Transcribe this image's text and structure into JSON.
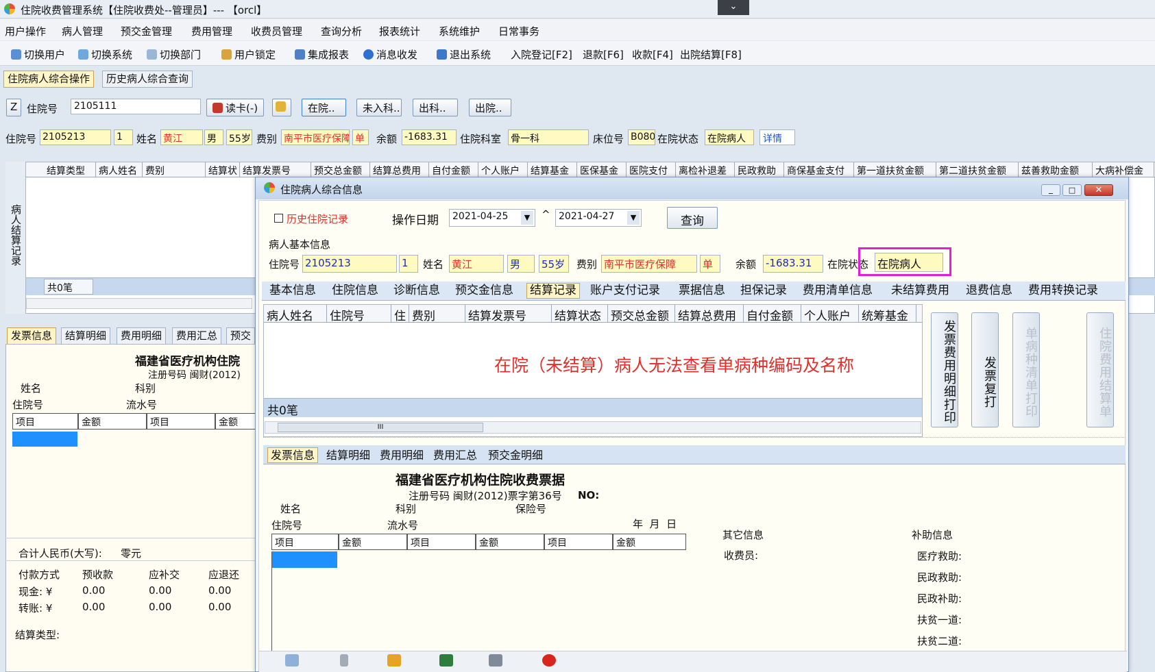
{
  "window": {
    "title": "住院收费管理系统【住院收费处--管理员】--- 【orcl】"
  },
  "menu": [
    "用户操作",
    "病人管理",
    "预交金管理",
    "费用管理",
    "收费员管理",
    "查询分析",
    "报表统计",
    "系统维护",
    "日常事务"
  ],
  "toolbar": [
    "切换用户",
    "切换系统",
    "切换部门",
    "用户锁定",
    "集成报表",
    "消息收发",
    "退出系统",
    "入院登记[F2]",
    "退款[F6]",
    "收款[F4]",
    "出院结算[F8]"
  ],
  "main_tabs": [
    "住院病人综合操作",
    "历史病人综合查询"
  ],
  "search": {
    "z": "Z",
    "label": "住院号",
    "value": "2105111",
    "read_card": "读卡(-)",
    "btn_inhosp": "在院..",
    "btn_notadmit": "未入科..",
    "btn_leave_dept": "出科..",
    "btn_discharge": "出院.."
  },
  "patient": {
    "id_label": "住院号",
    "id": "2105213",
    "times": "1",
    "name_label": "姓名",
    "name": "黄江",
    "sex": "男",
    "age": "55岁",
    "fee_type_label": "费别",
    "fee_type": "南平市医疗保障",
    "fee_flag": "单",
    "balance_label": "余额",
    "balance": "-1683.31",
    "dept_label": "住院科室",
    "dept": "骨一科",
    "bed_label": "床位号",
    "bed": "B080",
    "status_label": "在院状态",
    "status": "在院病人",
    "detail": "详情"
  },
  "left_grid": {
    "headers": [
      "结算类型",
      "病人姓名",
      "费别",
      "结算状",
      "结算发票号",
      "预交总金额",
      "结算总费用",
      "自付金额",
      "个人账户",
      "结算基金",
      "医保基金",
      "医院支付",
      "离检补退差",
      "民政救助",
      "商保基金支付",
      "第一道扶贫金额",
      "第二道扶贫金额",
      "兹善救助金额",
      "大病补偿金"
    ],
    "side_label": "病人结算记录",
    "count": "共0笔"
  },
  "left_bottom": {
    "tabs": [
      "发票信息",
      "结算明细",
      "费用明细",
      "费用汇总",
      "预交"
    ],
    "invoice_title": "福建省医疗机构住院",
    "reg": "注册号码 闽财(2012)",
    "name": "姓名",
    "dept": "科别",
    "inpatient_no": "住院号",
    "serial": "流水号",
    "cols": [
      "项目",
      "金额",
      "项目",
      "金额"
    ],
    "total_label": "合计人民币(大写):",
    "total_value": "零元",
    "pay_headers": [
      "付款方式",
      "预收款",
      "应补交",
      "应退还"
    ],
    "pay_rows": [
      [
        "现金: ¥",
        "0.00",
        "0.00",
        "0.00"
      ],
      [
        "转账: ¥",
        "0.00",
        "0.00",
        "0.00"
      ]
    ],
    "settle_type": "结算类型:"
  },
  "dialog": {
    "title": "住院病人综合信息",
    "history": "历史住院记录",
    "op_date": "操作日期",
    "date_from": "2021-04-25",
    "sep": "^",
    "date_to": "2021-04-27",
    "query": "查询",
    "basic_info": "病人基本信息",
    "status_label": "在院状态"
  },
  "dialog_tabs": [
    "基本信息",
    "住院信息",
    "诊断信息",
    "预交金信息",
    "结算记录",
    "账户支付记录",
    "票据信息",
    "担保记录",
    "费用清单信息",
    "未结算费用",
    "退费信息",
    "费用转换记录"
  ],
  "dialog_grid": {
    "headers": [
      "病人姓名",
      "住院号",
      "住",
      "费别",
      "结算发票号",
      "结算状态",
      "预交总金额",
      "结算总费用",
      "自付金额",
      "个人账户",
      "统筹基金"
    ],
    "note": "在院（未结算）病人无法查看单病种编码及名称",
    "count": "共0笔",
    "scroll": "III"
  },
  "side_buttons": [
    "发票费用明细打印",
    "发票复打",
    "单病种清单打印",
    "住院费用结算单"
  ],
  "dialog_bottom": {
    "tabs": [
      "发票信息",
      "结算明细",
      "费用明细",
      "费用汇总",
      "预交金明细"
    ],
    "invoice_title": "福建省医疗机构住院收费票据",
    "reg": "注册号码 闽财(2012)票字第36号",
    "no": "NO:",
    "name": "姓名",
    "dept": "科别",
    "insurance": "保险号",
    "inpatient_no": "住院号",
    "serial": "流水号",
    "ymd": "年  月  日",
    "cols": [
      "项目",
      "金额",
      "项目",
      "金额",
      "项目",
      "金额"
    ],
    "other": "其它信息",
    "cashier": "收费员:",
    "subsidy": "补助信息",
    "subsidies": [
      "医疗救助:",
      "民政救助:",
      "民政补助:",
      "扶贫一道:",
      "扶贫二道:"
    ]
  },
  "colors": {
    "highlight": "#e020d8",
    "note": "#e1302c",
    "selection": "#1e90ff"
  }
}
